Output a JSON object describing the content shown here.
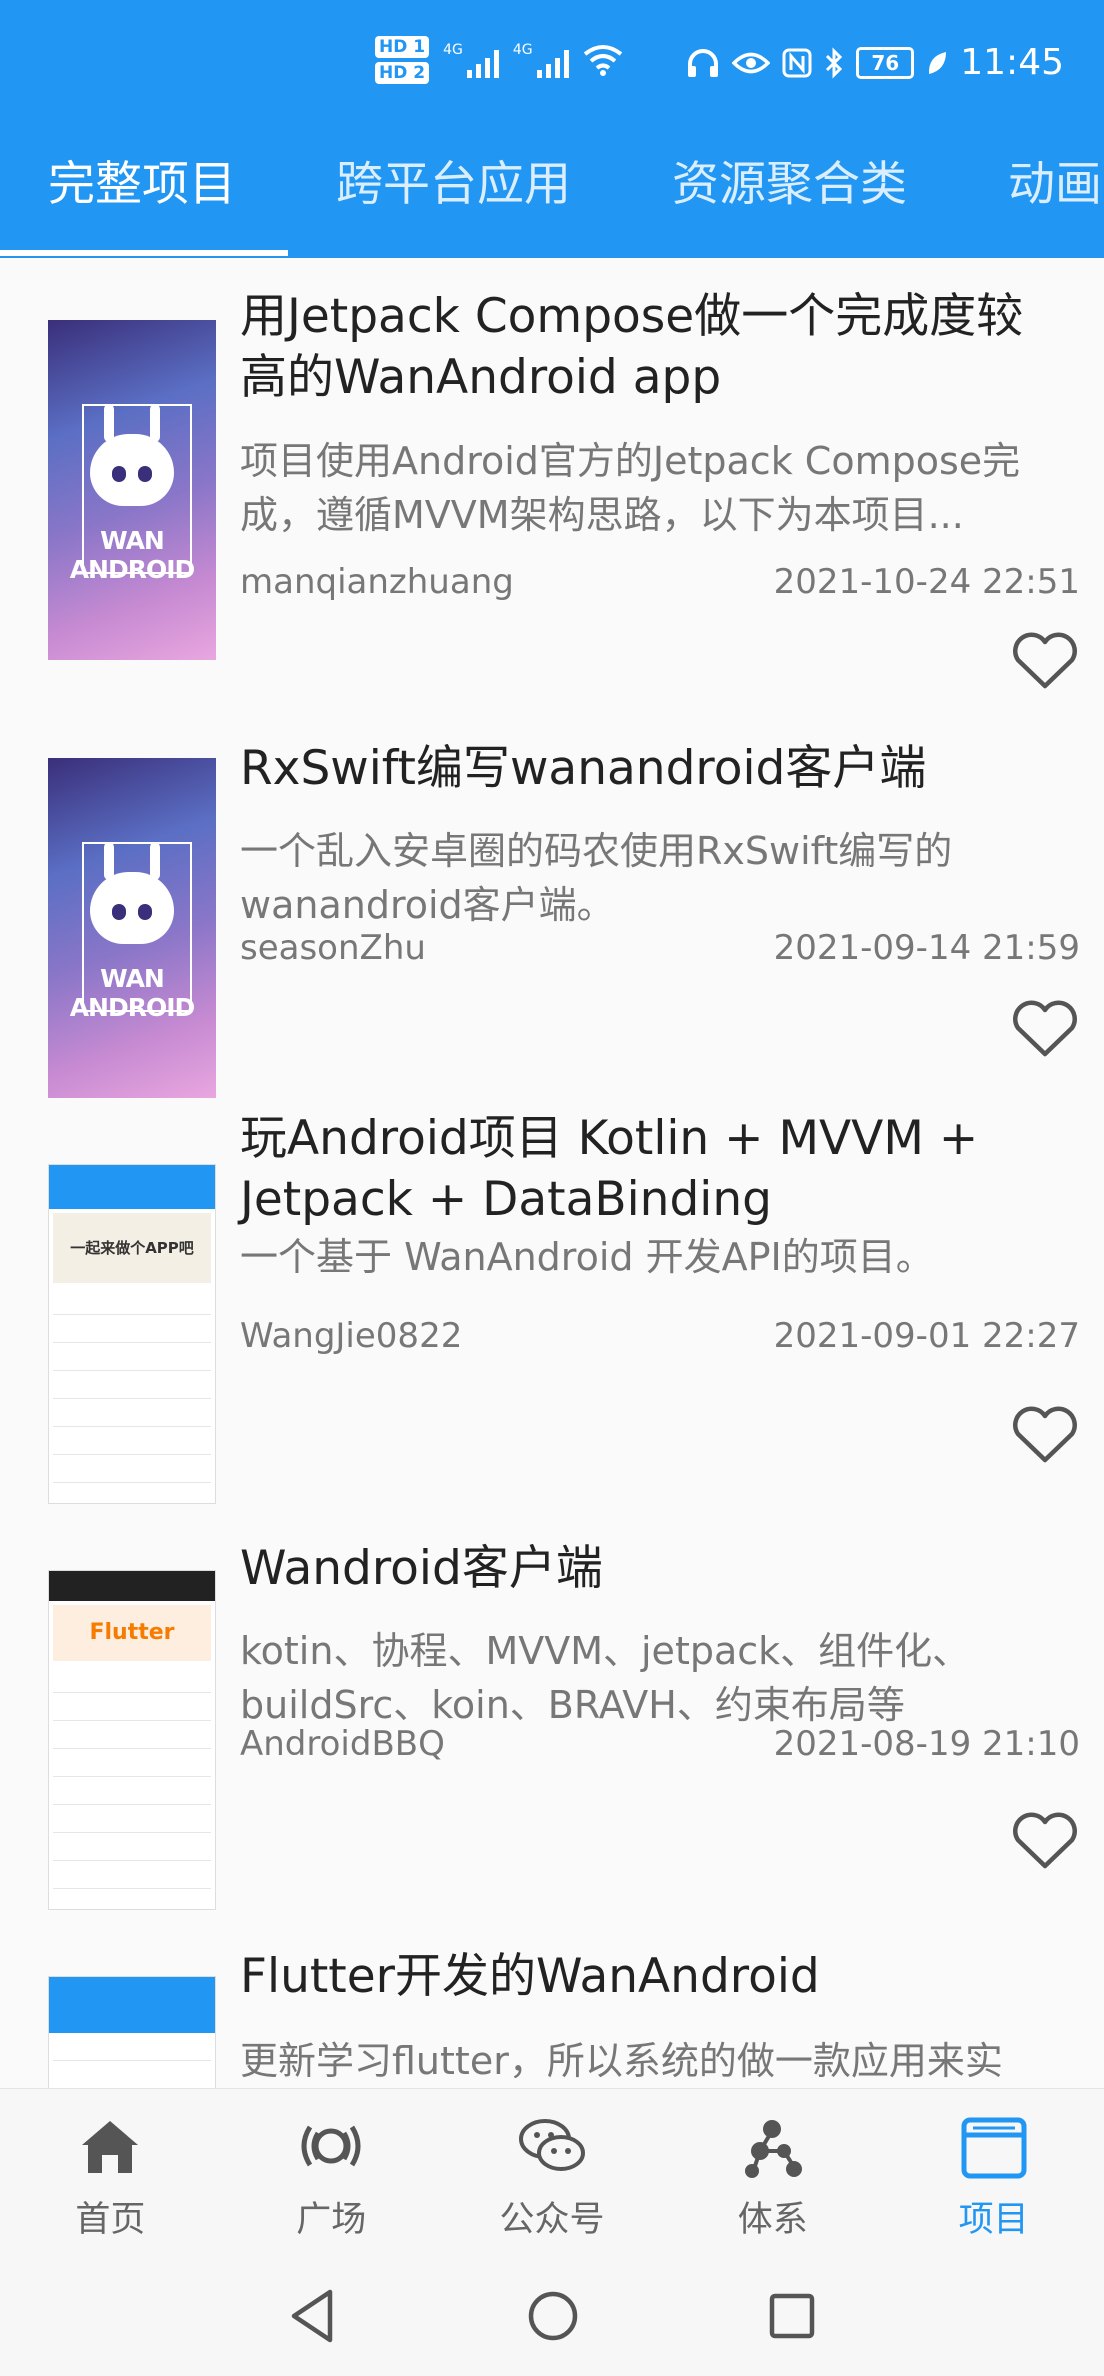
{
  "status_bar": {
    "sim1": "HD 1",
    "sim2": "HD 2",
    "net1": "4G",
    "net2": "4G",
    "battery": "76",
    "time": "11:45"
  },
  "tabs": [
    {
      "label": "完整项目",
      "active": true
    },
    {
      "label": "跨平台应用",
      "active": false
    },
    {
      "label": "资源聚合类",
      "active": false
    },
    {
      "label": "动画",
      "active": false
    }
  ],
  "projects": [
    {
      "title": "用Jetpack Compose做一个完成度较高的WanAndroid app",
      "desc": "项目使用Android官方的Jetpack Compose完成，遵循MVVM架构思路，以下为本项目...",
      "author": "manqianzhuang",
      "date": "2021-10-24 22:51",
      "thumb_text": "WAN ANDROID"
    },
    {
      "title": "RxSwift编写wanandroid客户端",
      "desc": "一个乱入安卓圈的码农使用RxSwift编写的wanandroid客户端。",
      "author": "seasonZhu",
      "date": "2021-09-14 21:59",
      "thumb_text": "WAN ANDROID"
    },
    {
      "title": "玩Android项目 Kotlin + MVVM + Jetpack + DataBinding",
      "desc": "一个基于 WanAndroid 开发API的项目。",
      "author": "WangJie0822",
      "date": "2021-09-01 22:27",
      "thumb_text": "一起来做个APP吧"
    },
    {
      "title": "Wandroid客户端",
      "desc": "kotin、协程、MVVM、jetpack、组件化、buildSrc、koin、BRAVH、约束布局等",
      "author": "AndroidBBQ",
      "date": "2021-08-19 21:10",
      "thumb_text": "Flutter"
    },
    {
      "title": "Flutter开发的WanAndroid",
      "desc": "更新学习flutter，所以系统的做一款应用来实",
      "author": "",
      "date": "",
      "thumb_text": ""
    }
  ],
  "bottom_nav": [
    {
      "label": "首页",
      "icon": "home-icon"
    },
    {
      "label": "广场",
      "icon": "broadcast-icon"
    },
    {
      "label": "公众号",
      "icon": "wechat-icon"
    },
    {
      "label": "体系",
      "icon": "molecule-icon"
    },
    {
      "label": "项目",
      "icon": "window-icon",
      "active": true
    }
  ],
  "colors": {
    "primary": "#2196f3",
    "text": "#222222",
    "muted": "#777777",
    "nav_inactive": "#666666"
  }
}
